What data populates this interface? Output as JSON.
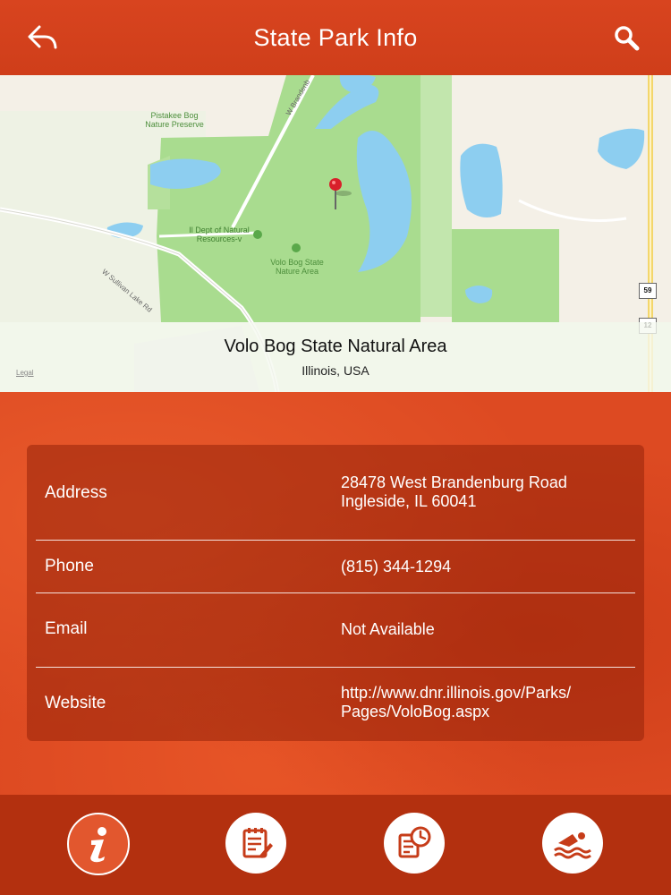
{
  "header": {
    "title": "State Park Info",
    "back_icon": "back-arrow-icon",
    "search_icon": "search-icon"
  },
  "map": {
    "labels": {
      "pistakee": "Pistakee Bog\nNature Preserve",
      "dnr": "Il Dept of Natural\nResources-v",
      "volo": "Volo Bog State\nNature Area",
      "road_sullivan": "W Sullivan Lake Rd",
      "road_brandenburg": "W Brandenb"
    },
    "shields": [
      "59",
      "12"
    ],
    "legal": "Legal",
    "place_name": "Volo Bog State Natural Area",
    "place_region": "Illinois, USA"
  },
  "info": {
    "address_label": "Address",
    "address_line1": "28478 West Brandenburg Road",
    "address_line2": "Ingleside, IL 60041",
    "phone_label": "Phone",
    "phone_value": "(815) 344-1294",
    "email_label": "Email",
    "email_value": "Not Available",
    "website_label": "Website",
    "website_line1": "http://www.dnr.illinois.gov/Parks/",
    "website_line2": "Pages/VoloBog.aspx"
  },
  "tabs": [
    {
      "name": "info",
      "icon": "info-icon",
      "active": true
    },
    {
      "name": "notes",
      "icon": "notes-icon",
      "active": false
    },
    {
      "name": "schedule",
      "icon": "schedule-clock-icon",
      "active": false
    },
    {
      "name": "activities",
      "icon": "swimmer-icon",
      "active": false
    }
  ],
  "colors": {
    "primary": "#d8441f",
    "tabbar": "#b3300f",
    "active_tab": "#e2572e",
    "park_green": "#a8dc8c",
    "water": "#8ccff0"
  }
}
